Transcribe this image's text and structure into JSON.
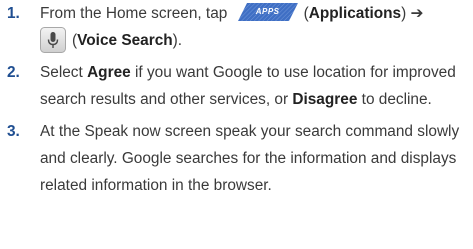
{
  "steps": [
    {
      "number": "1.",
      "prefix": "From the Home screen, tap",
      "apps_icon": {
        "name": "apps-icon",
        "label": "APPS"
      },
      "apps_name": "(Applications)",
      "arrow": "➔",
      "mic_icon": {
        "name": "microphone-icon"
      },
      "voice_name": "(Voice Search).",
      "voice_open_paren": "(",
      "voice_bold": "Voice Search",
      "voice_close": ").",
      "apps_open_paren": "(",
      "apps_bold": "Applications",
      "apps_close": ")"
    },
    {
      "number": "2.",
      "text_before_agree": "Select",
      "agree": "Agree",
      "text_middle": "if you want Google to use location for improved search results and other services, or",
      "disagree": "Disagree",
      "text_after": "to decline."
    },
    {
      "number": "3.",
      "text": "At the Speak now screen speak your search command slowly and clearly. Google searches for the information and displays related information in the browser."
    }
  ],
  "colors": {
    "step_number": "#1f4e91",
    "body_text": "#3a3a3a",
    "apps_icon_fill": "#3f6fc4"
  }
}
